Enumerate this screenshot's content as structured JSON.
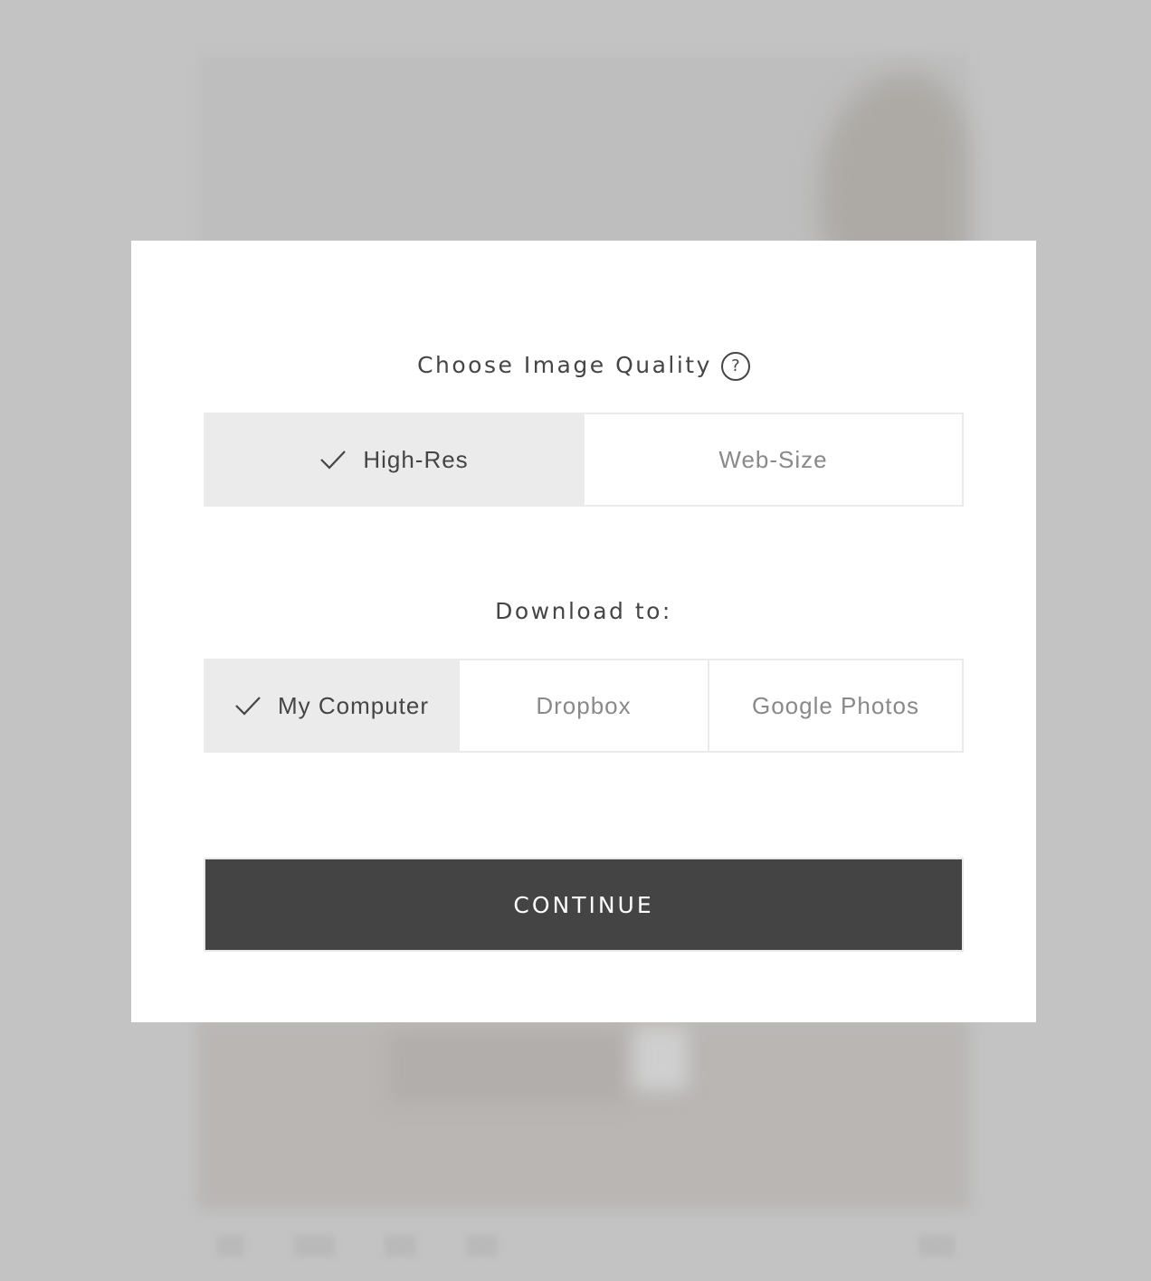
{
  "dialog": {
    "quality_title": "Choose Image Quality",
    "help_icon_glyph": "?",
    "quality_options": [
      {
        "label": "High-Res",
        "selected": true
      },
      {
        "label": "Web-Size",
        "selected": false
      }
    ],
    "download_title": "Download to:",
    "download_options": [
      {
        "label": "My Computer",
        "selected": true
      },
      {
        "label": "Dropbox",
        "selected": false
      },
      {
        "label": "Google Photos",
        "selected": false
      }
    ],
    "continue_label": "CONTINUE"
  },
  "colors": {
    "backdrop": "#c3c3c3",
    "selected_bg": "#ebebeb",
    "selected_text": "#454545",
    "unselected_text": "#898989",
    "button_bg": "#444444",
    "button_text": "#ffffff"
  },
  "icons": {
    "help": "question-circle-icon",
    "check": "checkmark-icon"
  }
}
